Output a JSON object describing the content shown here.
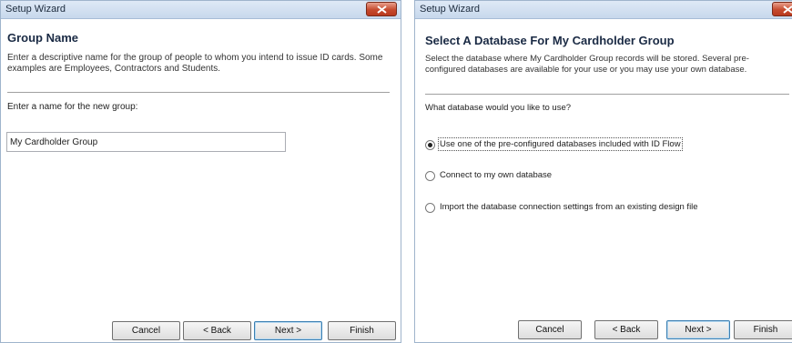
{
  "left_window": {
    "title": "Setup Wizard",
    "heading": "Group Name",
    "description": "Enter a descriptive name for the group of people to whom you intend to issue ID cards. Some examples are Employees, Contractors and Students.",
    "field_label": "Enter a name for the new group:",
    "group_name_value": "My Cardholder Group",
    "buttons": {
      "cancel": "Cancel",
      "back": "< Back",
      "next": "Next >",
      "finish": "Finish"
    }
  },
  "right_window": {
    "title": "Setup Wizard",
    "heading": "Select A Database For My Cardholder Group",
    "description": "Select the database where My Cardholder Group records will be stored. Several pre-configured databases are available for your use or you may use your own database.",
    "question": "What database would you like to use?",
    "options": [
      {
        "label": "Use one of the pre-configured databases included with ID Flow",
        "selected": true
      },
      {
        "label": "Connect to my own database",
        "selected": false
      },
      {
        "label": "Import the database connection settings from an existing design file",
        "selected": false
      }
    ],
    "buttons": {
      "cancel": "Cancel",
      "back": "< Back",
      "next": "Next >",
      "finish": "Finish"
    }
  },
  "colors": {
    "titlebar": "#c7d8ec",
    "close_button": "#c64a2e",
    "heading": "#1a2a44"
  },
  "icons": {
    "close": "close-x-icon"
  }
}
